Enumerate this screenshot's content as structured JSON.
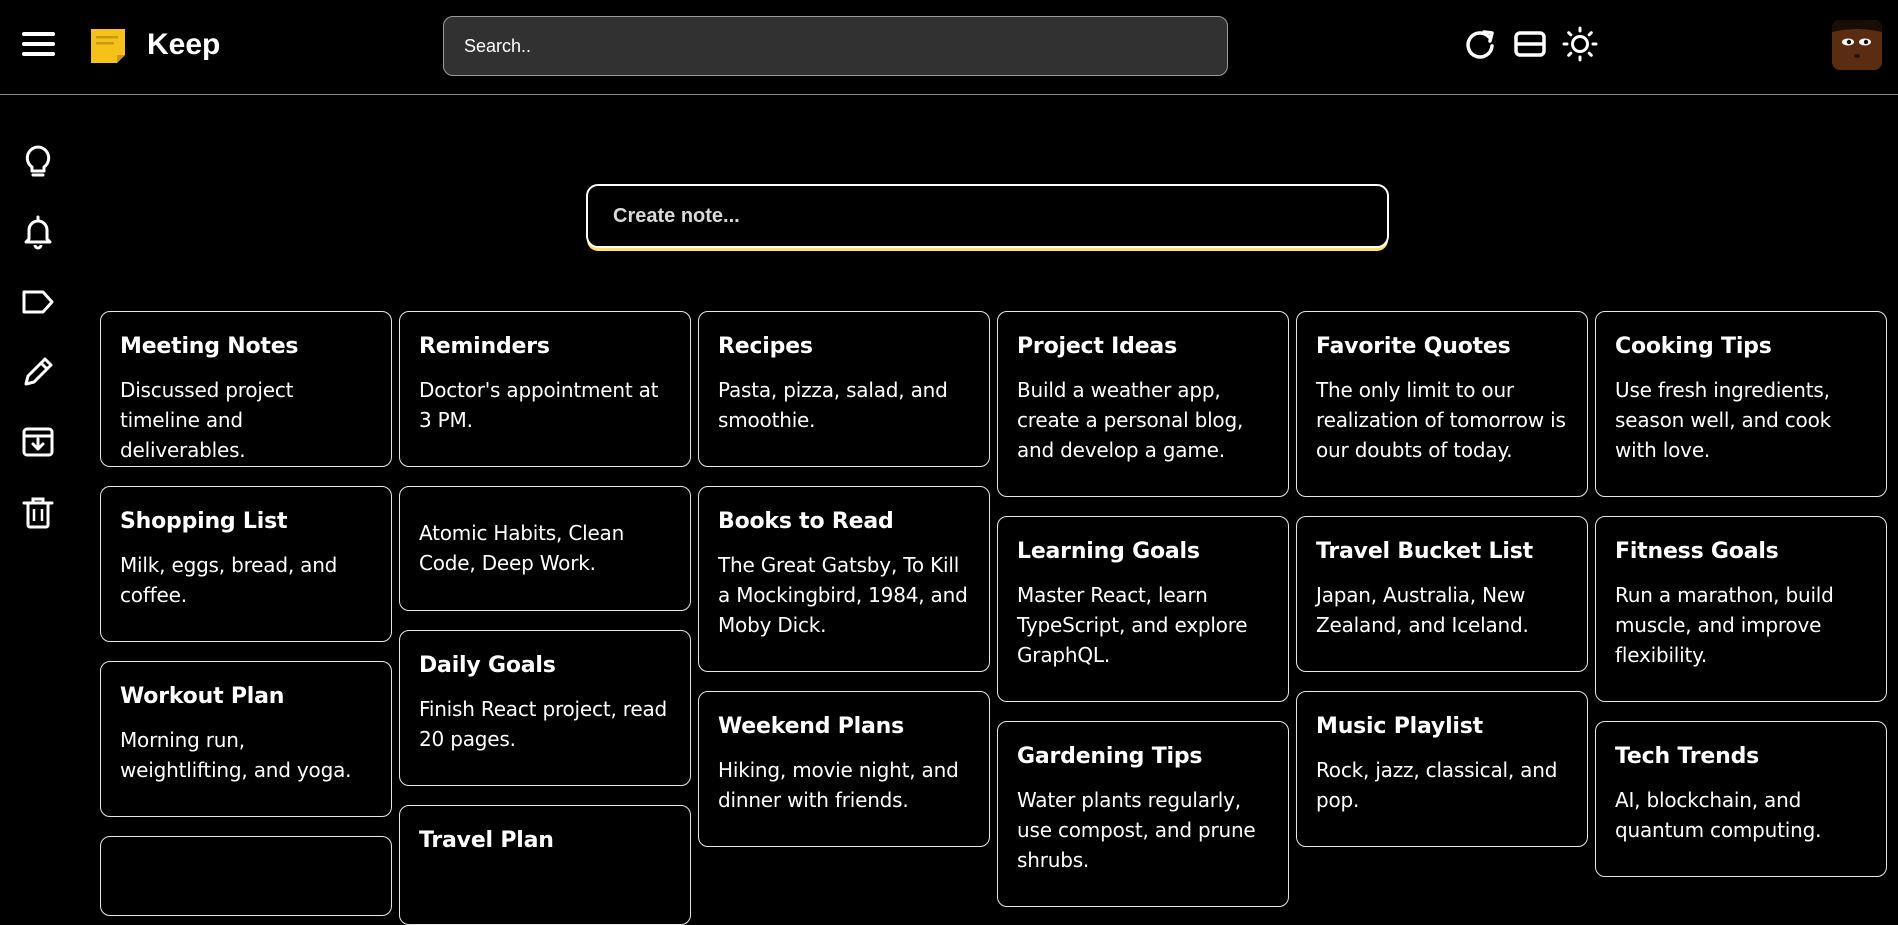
{
  "app": {
    "title": "Keep"
  },
  "search": {
    "placeholder": "Search.."
  },
  "toolbar": {
    "icons": [
      "refresh-icon",
      "list-view-icon",
      "theme-toggle-icon"
    ]
  },
  "sidebar": {
    "icons": [
      "notes-bulb-icon",
      "reminders-bell-icon",
      "labels-tag-icon",
      "edit-pencil-icon",
      "archive-icon",
      "trash-icon"
    ]
  },
  "create": {
    "placeholder": "Create note..."
  },
  "colors": {
    "accent": "#ffe45c",
    "background": "#000000",
    "search_bg": "#313131"
  },
  "notes": [
    {
      "title": "Meeting Notes",
      "body": "Discussed project timeline and deliverables."
    },
    {
      "title": "Shopping List",
      "body": "Milk, eggs, bread, and coffee."
    },
    {
      "title": "Workout Plan",
      "body": "Morning run, weightlifting, and yoga."
    },
    {
      "title": "Reminders",
      "body": "Doctor's appointment at 3 PM."
    },
    {
      "title": "",
      "body": "Atomic Habits, Clean Code, Deep Work."
    },
    {
      "title": "Daily Goals",
      "body": "Finish React project, read 20 pages."
    },
    {
      "title": "Travel Plan",
      "body": ""
    },
    {
      "title": "Recipes",
      "body": "Pasta, pizza, salad, and smoothie."
    },
    {
      "title": "Books to Read",
      "body": "The Great Gatsby, To Kill a Mockingbird, 1984, and Moby Dick."
    },
    {
      "title": "Weekend Plans",
      "body": "Hiking, movie night, and dinner with friends."
    },
    {
      "title": "Project Ideas",
      "body": "Build a weather app, create a personal blog, and develop a game."
    },
    {
      "title": "Learning Goals",
      "body": "Master React, learn TypeScript, and explore GraphQL."
    },
    {
      "title": "Gardening Tips",
      "body": "Water plants regularly, use compost, and prune shrubs."
    },
    {
      "title": "Favorite Quotes",
      "body": "The only limit to our realization of tomorrow is our doubts of today."
    },
    {
      "title": "Travel Bucket List",
      "body": "Japan, Australia, New Zealand, and Iceland."
    },
    {
      "title": "Music Playlist",
      "body": "Rock, jazz, classical, and pop."
    },
    {
      "title": "Cooking Tips",
      "body": "Use fresh ingredients, season well, and cook with love."
    },
    {
      "title": "Fitness Goals",
      "body": "Run a marathon, build muscle, and improve flexibility."
    },
    {
      "title": "Tech Trends",
      "body": "AI, blockchain, and quantum computing."
    }
  ]
}
